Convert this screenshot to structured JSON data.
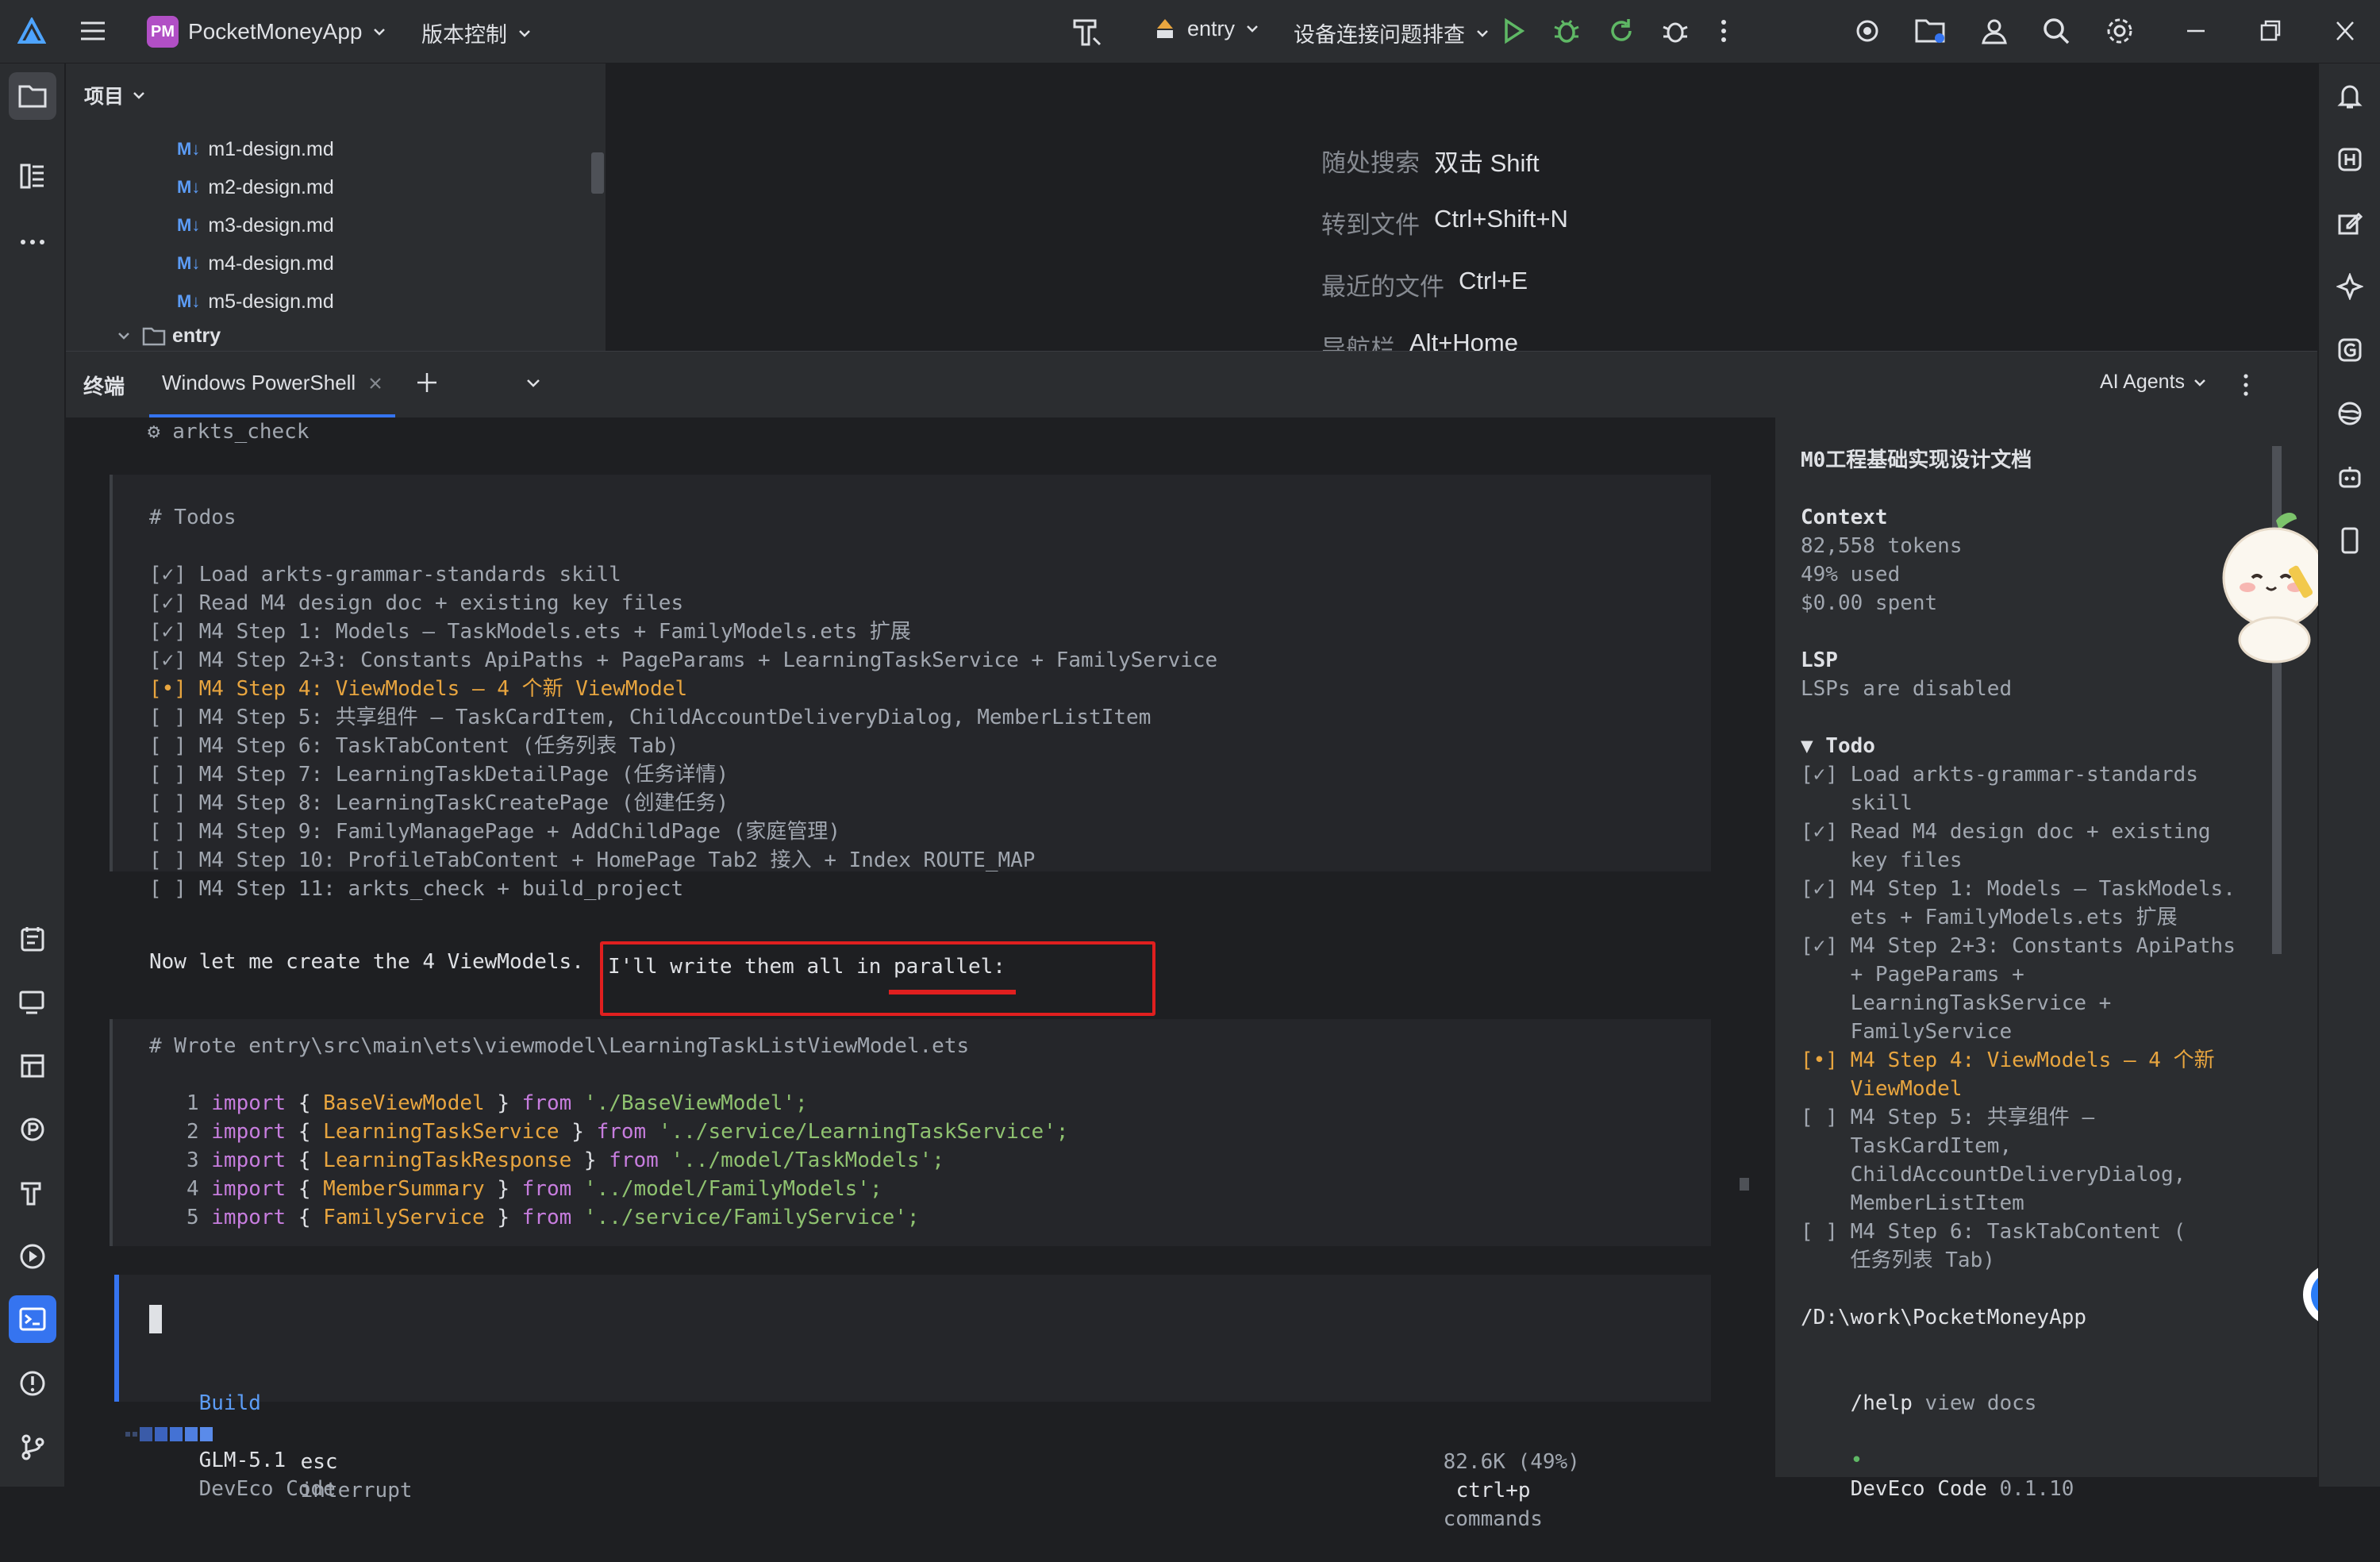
{
  "titlebar": {
    "project_badge": "PM",
    "project_name": "PocketMoneyApp",
    "vcs_label": "版本控制",
    "run_config": "entry",
    "device_label": "设备连接问题排查",
    "colors": {
      "run": "#5fb865",
      "badge": "#b14fc5"
    }
  },
  "project_panel": {
    "title": "项目",
    "files": [
      "m1-design.md",
      "m2-design.md",
      "m3-design.md",
      "m4-design.md",
      "m5-design.md"
    ],
    "md_badge": "M↓",
    "folder": "entry"
  },
  "editor_hints": [
    {
      "label": "随处搜索",
      "key": "双击 Shift"
    },
    {
      "label": "转到文件",
      "key": "Ctrl+Shift+N"
    },
    {
      "label": "最近的文件",
      "key": "Ctrl+E"
    },
    {
      "label": "导航栏",
      "key": "Alt+Home"
    }
  ],
  "terminal": {
    "title": "终端",
    "tab": "Windows PowerShell",
    "agents_label": "AI Agents",
    "tool_line": "⚙ arkts_check",
    "todos_heading": "# Todos",
    "todos": [
      {
        "mark": "[✓]",
        "text": "Load arkts-grammar-standards skill",
        "state": "done"
      },
      {
        "mark": "[✓]",
        "text": "Read M4 design doc + existing key files",
        "state": "done"
      },
      {
        "mark": "[✓]",
        "text": "M4 Step 1: Models — TaskModels.ets + FamilyModels.ets 扩展",
        "state": "done"
      },
      {
        "mark": "[✓]",
        "text": "M4 Step 2+3: Constants ApiPaths + PageParams + LearningTaskService + FamilyService",
        "state": "done"
      },
      {
        "mark": "[•]",
        "text": "M4 Step 4: ViewModels — 4 个新 ViewModel",
        "state": "current"
      },
      {
        "mark": "[ ]",
        "text": "M4 Step 5: 共享组件 — TaskCardItem, ChildAccountDeliveryDialog, MemberListItem",
        "state": "todo"
      },
      {
        "mark": "[ ]",
        "text": "M4 Step 6: TaskTabContent (任务列表 Tab)",
        "state": "todo"
      },
      {
        "mark": "[ ]",
        "text": "M4 Step 7: LearningTaskDetailPage (任务详情)",
        "state": "todo"
      },
      {
        "mark": "[ ]",
        "text": "M4 Step 8: LearningTaskCreatePage (创建任务)",
        "state": "todo"
      },
      {
        "mark": "[ ]",
        "text": "M4 Step 9: FamilyManagePage + AddChildPage (家庭管理)",
        "state": "todo"
      },
      {
        "mark": "[ ]",
        "text": "M4 Step 10: ProfileTabContent + HomePage Tab2 接入 + Index ROUTE_MAP",
        "state": "todo"
      },
      {
        "mark": "[ ]",
        "text": "M4 Step 11: arkts_check + build_project",
        "state": "todo"
      }
    ],
    "message_a": "Now let me create the 4 ViewModels. ",
    "message_b": "I'll write them all in parallel:",
    "wrote_line": "# Wrote entry\\src\\main\\ets\\viewmodel\\LearningTaskListViewModel.ets",
    "code": [
      {
        "n": "1",
        "name": "BaseViewModel",
        "path": "'./BaseViewModel';"
      },
      {
        "n": "2",
        "name": "LearningTaskService",
        "path": "'../service/LearningTaskService';"
      },
      {
        "n": "3",
        "name": "LearningTaskResponse",
        "path": "'../model/TaskModels';"
      },
      {
        "n": "4",
        "name": "MemberSummary",
        "path": "'../model/FamilyModels';"
      },
      {
        "n": "5",
        "name": "FamilyService",
        "path": "'../service/FamilyService';"
      }
    ],
    "kw_import": "import",
    "kw_from": "from",
    "brace_open": "{",
    "brace_close": "}",
    "mode": "Build",
    "dot": "·",
    "model": "GLM-5.1",
    "provider": "DevEco Code",
    "esc": "esc",
    "interrupt": "interrupt",
    "usage": "82.6K (49%)",
    "shortcut": "ctrl+p",
    "commands": "commands"
  },
  "sidebar": {
    "title": "M0工程基础实现设计文档",
    "context_heading": "Context",
    "tokens": "82,558 tokens",
    "used": "49% used",
    "spent": "$0.00 spent",
    "lsp_heading": "LSP",
    "lsp_status": "LSPs are disabled",
    "todo_heading": "▼ Todo",
    "todos": [
      {
        "lines": [
          "[✓] Load arkts-grammar-standards",
          "    skill"
        ],
        "state": "done"
      },
      {
        "lines": [
          "[✓] Read M4 design doc + existing",
          "    key files"
        ],
        "state": "done"
      },
      {
        "lines": [
          "[✓] M4 Step 1: Models — TaskModels.",
          "    ets + FamilyModels.ets 扩展"
        ],
        "state": "done"
      },
      {
        "lines": [
          "[✓] M4 Step 2+3: Constants ApiPaths",
          "    + PageParams +",
          "    LearningTaskService +",
          "    FamilyService"
        ],
        "state": "done"
      },
      {
        "lines": [
          "[•] M4 Step 4: ViewModels — 4 个新",
          "    ViewModel"
        ],
        "state": "current"
      },
      {
        "lines": [
          "[ ] M4 Step 5: 共享组件 —",
          "    TaskCardItem,",
          "    ChildAccountDeliveryDialog,",
          "    MemberListItem"
        ],
        "state": "todo"
      },
      {
        "lines": [
          "[ ] M4 Step 6: TaskTabContent (",
          "    任务列表 Tab)"
        ],
        "state": "todo"
      }
    ],
    "path": "/D:\\work\\PocketMoneyApp",
    "help_cmd": "/help",
    "help_text": " view docs",
    "brand": "DevEco Code",
    "version": " 0.1.10",
    "bullet": "•"
  }
}
